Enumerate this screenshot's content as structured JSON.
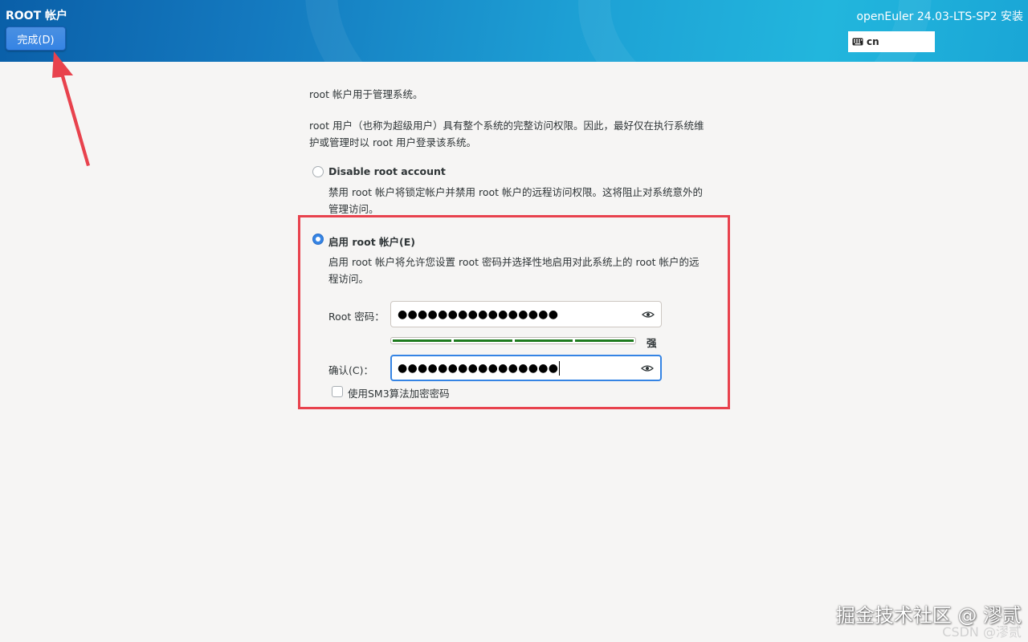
{
  "header": {
    "spoke_title": "ROOT 帐户",
    "done_label": "完成(D)",
    "product_title": "openEuler 24.03-LTS-SP2 安装",
    "keyboard_layout": "cn"
  },
  "intro": {
    "line1": "root 帐户用于管理系统。",
    "line2a": "root 用户（也称为超级用户）具有整个系统的完整访问权限。因此，最好仅在执行系统维",
    "line2b": "护或管理时以 root 用户登录该系统。"
  },
  "disable_option": {
    "label": "Disable root account",
    "selected": false,
    "desc_a": "禁用 root 帐户将锁定帐户并禁用 root 帐户的远程访问权限。这将阻止对系统意外的",
    "desc_b": "管理访问。"
  },
  "enable_option": {
    "label": "启用 root 帐户(E)",
    "selected": true,
    "desc_a": "启用 root 帐户将允许您设置 root 密码并选择性地启用对此系统上的 root 帐户的远",
    "desc_b": "程访问。"
  },
  "password": {
    "label": "Root 密码：",
    "value": "●●●●●●●●●●●●●●●●"
  },
  "strength": {
    "level": 1.0,
    "label": "强"
  },
  "confirm": {
    "label": "确认(C)：",
    "value": "●●●●●●●●●●●●●●●●"
  },
  "sm3": {
    "label": "使用SM3算法加密密码",
    "checked": false
  },
  "watermarks": {
    "main": "掘金技术社区 @ 漻贰",
    "sub": "CSDN @漻贰"
  },
  "colors": {
    "accent": "#3584e4",
    "highlight": "#e8424d",
    "strength": "#1e7a1e"
  }
}
